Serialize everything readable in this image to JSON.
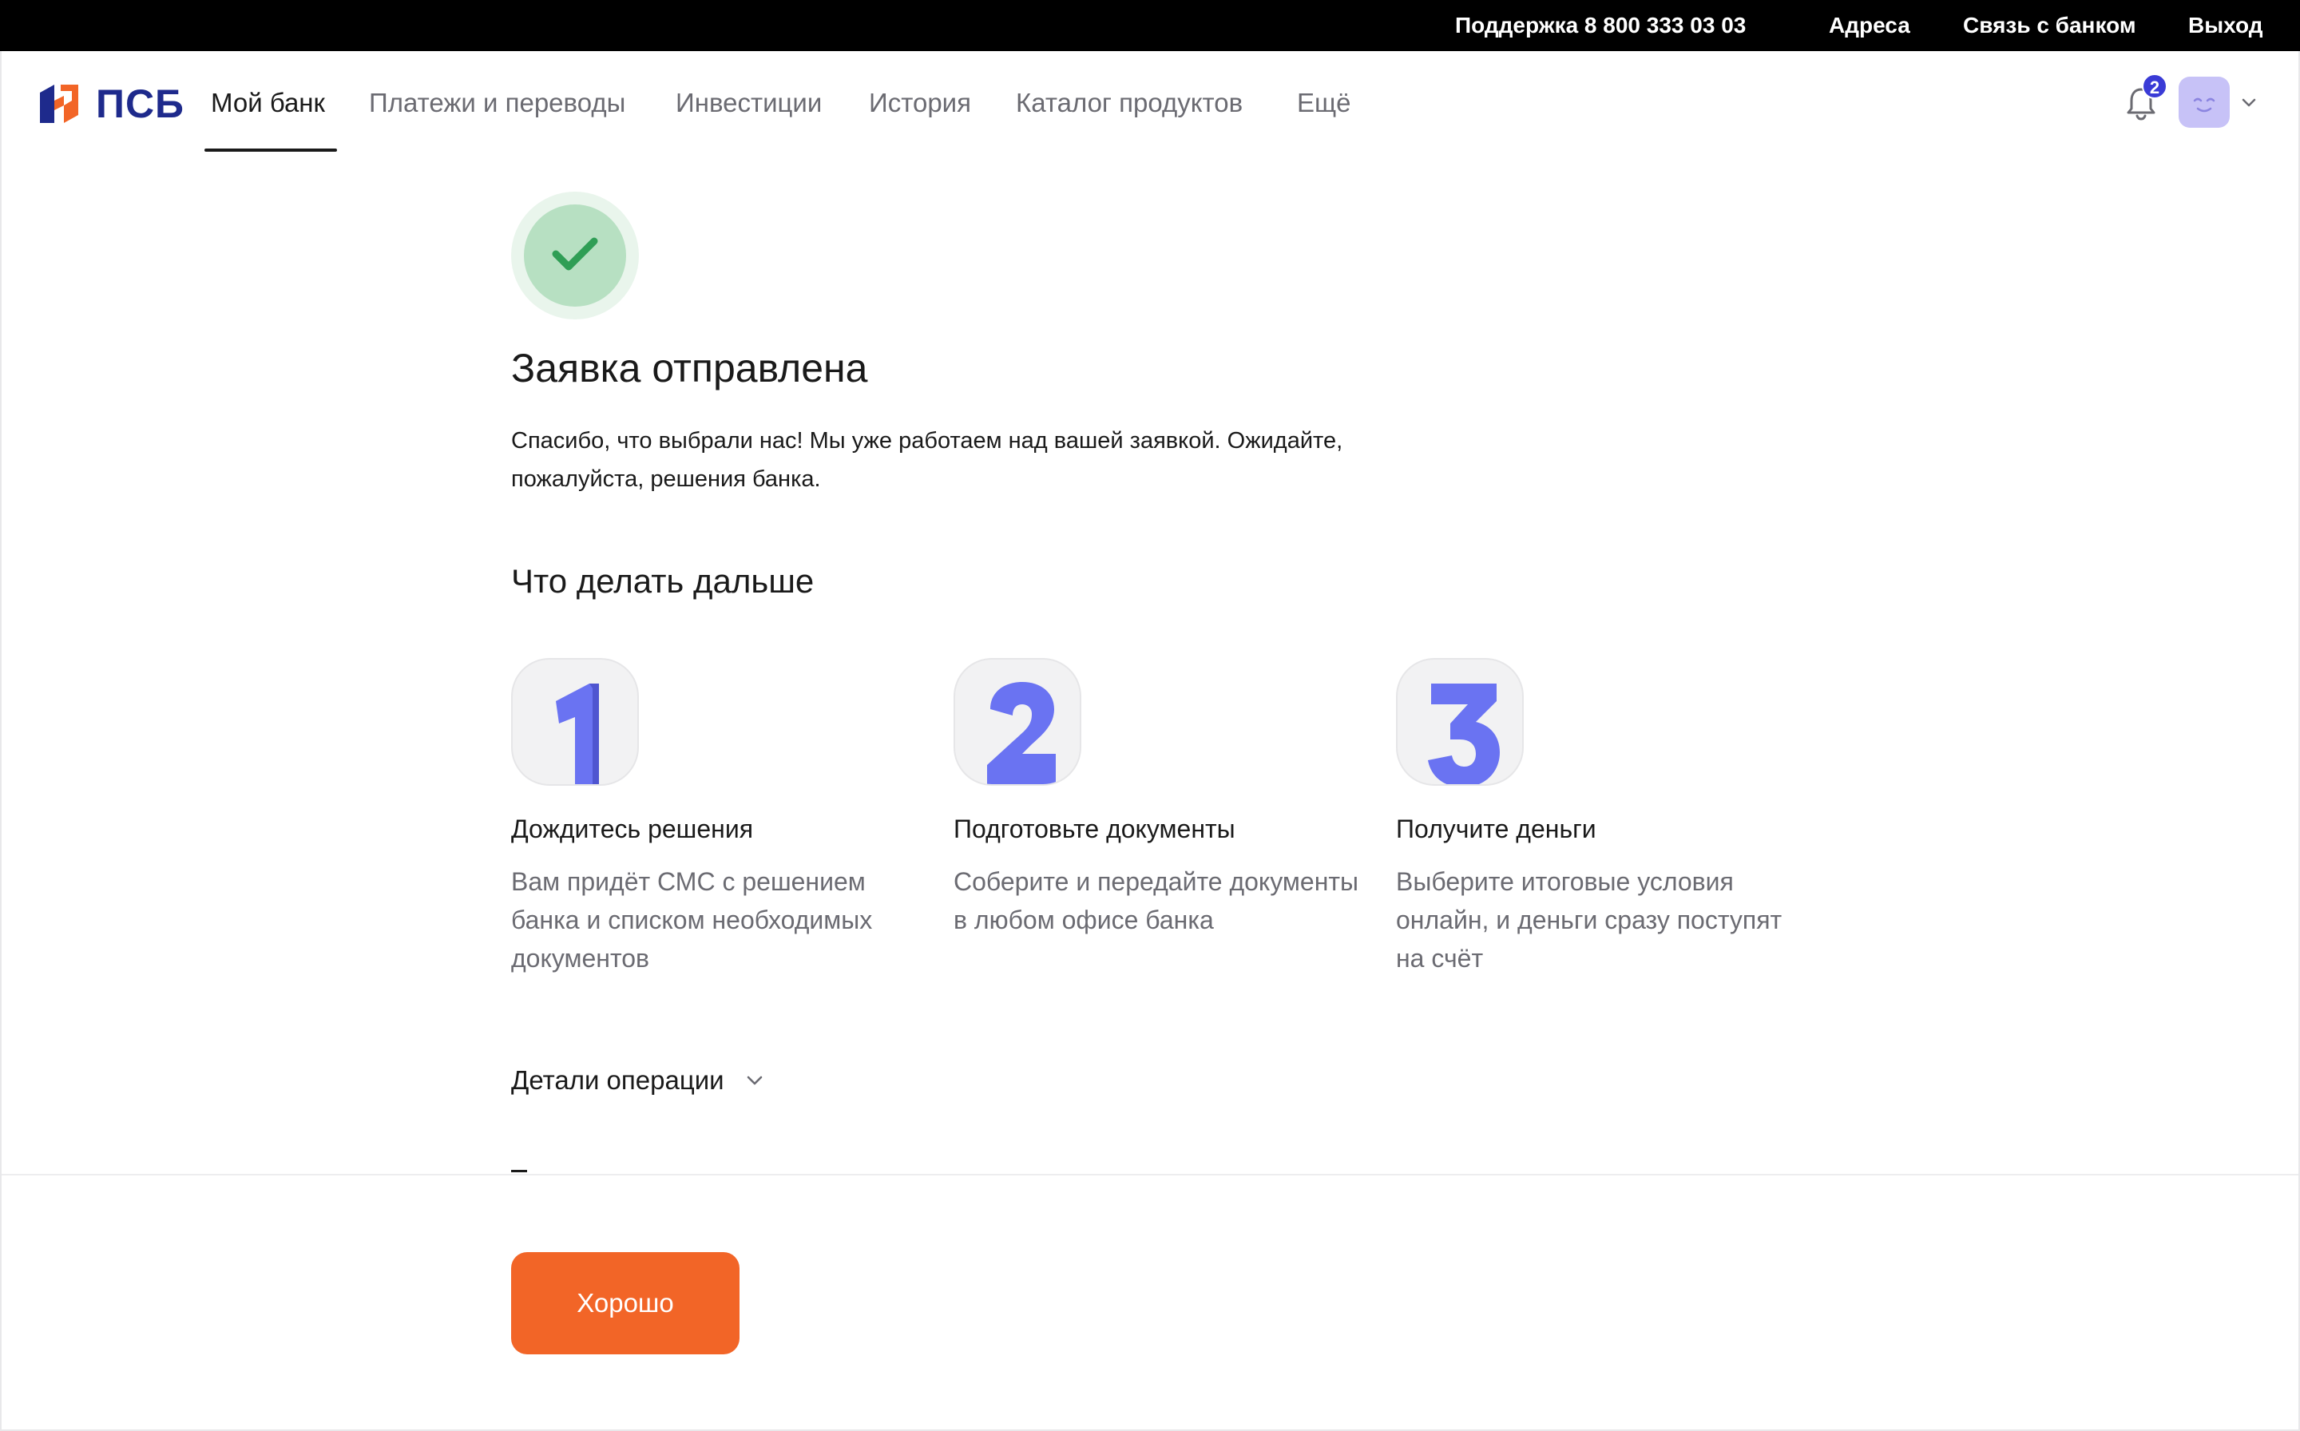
{
  "topbar": {
    "support": "Поддержка 8 800 333 03 03",
    "addresses": "Адреса",
    "contact": "Связь с банком",
    "logout": "Выход"
  },
  "header": {
    "logo_text": "ПСБ",
    "nav": [
      {
        "label": "Мой банк",
        "active": true
      },
      {
        "label": "Платежи и переводы"
      },
      {
        "label": "Инвестиции"
      },
      {
        "label": "История"
      },
      {
        "label": "Каталог продуктов"
      },
      {
        "label": "Ещё"
      }
    ],
    "notifications_count": "2"
  },
  "main": {
    "title": "Заявка отправлена",
    "lead": "Спасибо, что выбрали нас! Мы уже работаем над вашей заявкой. Ожидайте, пожалуйста, решения банка.",
    "next_heading": "Что делать дальше",
    "steps": [
      {
        "number": "1",
        "title": "Дождитесь решения",
        "text": "Вам придёт СМС с решением банка и списком необходимых документов"
      },
      {
        "number": "2",
        "title": "Подготовьте документы",
        "text": "Соберите и передайте документы в любом офисе банка"
      },
      {
        "number": "3",
        "title": "Получите деньги",
        "text": "Выберите итоговые условия онлайн, и деньги сразу поступят на счёт"
      }
    ],
    "details_label": "Детали операции"
  },
  "footer": {
    "ok_label": "Хорошо"
  },
  "colors": {
    "accent": "#f26527",
    "brand": "#1e2a8c",
    "step_number": "#6a73f2",
    "success": "#2f9e55"
  }
}
